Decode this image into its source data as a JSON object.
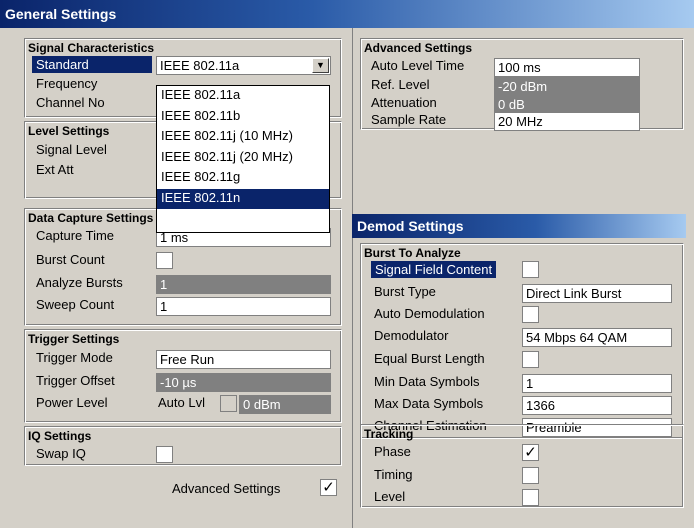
{
  "window": {
    "title": "General Settings"
  },
  "signal": {
    "heading": "Signal Characteristics",
    "standard_label": "Standard",
    "standard_value": "IEEE 802.11a",
    "frequency_label": "Frequency",
    "channel_label": "Channel No",
    "dropdown_options": [
      "IEEE 802.11a",
      "IEEE 802.11b",
      "IEEE 802.11j (10 MHz)",
      "IEEE 802.11j (20 MHz)",
      "IEEE 802.11g",
      "IEEE 802.11n"
    ],
    "dropdown_selected": "IEEE 802.11n"
  },
  "level": {
    "heading": "Level Settings",
    "signal_level_label": "Signal Level",
    "ext_att_label": "Ext Att"
  },
  "capture": {
    "heading": "Data Capture Settings",
    "capture_time_label": "Capture Time",
    "capture_time_value": "1 ms",
    "burst_count_label": "Burst Count",
    "analyze_bursts_label": "Analyze Bursts",
    "analyze_bursts_value": "1",
    "sweep_count_label": "Sweep Count",
    "sweep_count_value": "1"
  },
  "trigger": {
    "heading": "Trigger Settings",
    "mode_label": "Trigger Mode",
    "mode_value": "Free Run",
    "offset_label": "Trigger Offset",
    "offset_value": "-10 µs",
    "power_label": "Power Level",
    "power_auto": "Auto Lvl",
    "power_value": "0 dBm"
  },
  "iq": {
    "heading": "IQ Settings",
    "swap_label": "Swap IQ"
  },
  "advanced_toggle": {
    "label": "Advanced Settings",
    "check": "✓"
  },
  "advanced": {
    "heading": "Advanced Settings",
    "auto_level_time_label": "Auto Level Time",
    "auto_level_time_value": "100 ms",
    "ref_level_label": "Ref. Level",
    "ref_level_value": "-20 dBm",
    "attenuation_label": "Attenuation",
    "attenuation_value": "0 dB",
    "sample_rate_label": "Sample Rate",
    "sample_rate_value": "20 MHz"
  },
  "demod": {
    "title": "Demod Settings",
    "burst_heading": "Burst To Analyze",
    "signal_field_label": "Signal Field Content",
    "burst_type_label": "Burst Type",
    "burst_type_value": "Direct Link Burst",
    "auto_demod_label": "Auto Demodulation",
    "demodulator_label": "Demodulator",
    "demodulator_value": "54 Mbps 64 QAM",
    "equal_burst_label": "Equal Burst Length",
    "min_sym_label": "Min Data Symbols",
    "min_sym_value": "1",
    "max_sym_label": "Max Data Symbols",
    "max_sym_value": "1366",
    "chan_est_label": "Channel Estimation",
    "chan_est_value": "Preamble"
  },
  "tracking": {
    "heading": "Tracking",
    "phase_label": "Phase",
    "phase_check": "✓",
    "timing_label": "Timing",
    "level_label": "Level"
  }
}
